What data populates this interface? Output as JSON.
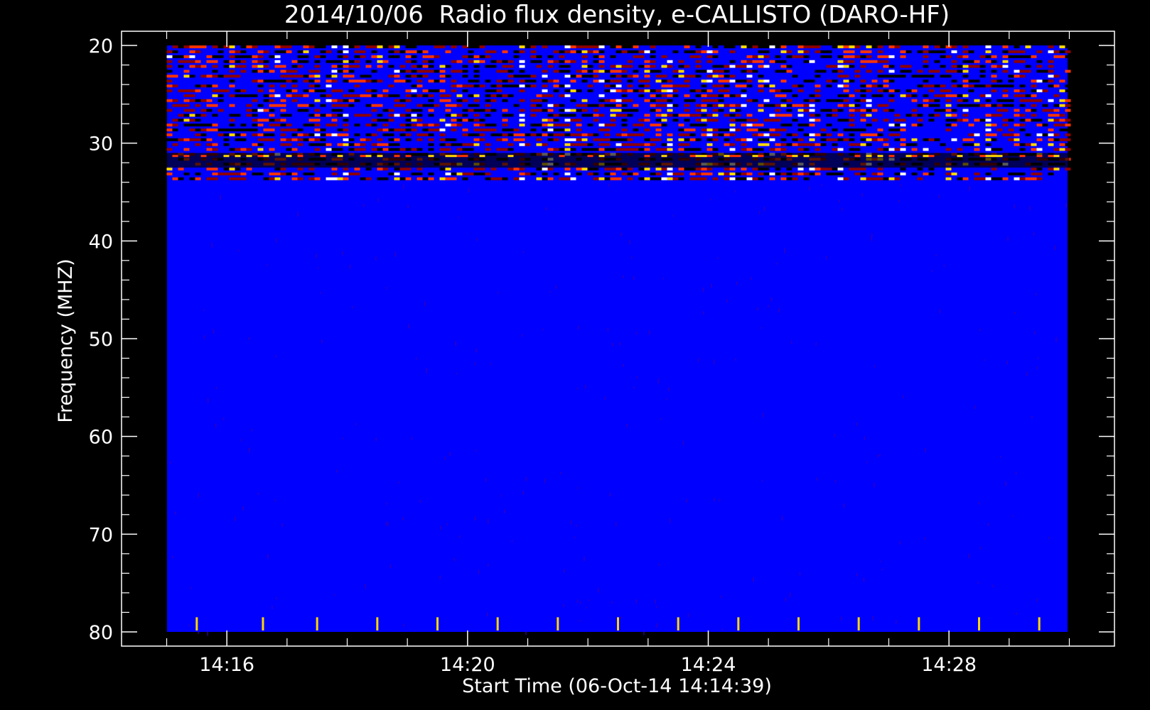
{
  "chart_data": {
    "type": "heatmap",
    "title": "2014/10/06  Radio flux density, e-CALLISTO (DARO-HF)",
    "xlabel": "Start Time (06-Oct-14 14:14:39)",
    "ylabel": "Frequency (MHZ)",
    "x_tick_labels": [
      "14:16",
      "14:20",
      "14:24",
      "14:28"
    ],
    "y_tick_labels": [
      "20",
      "30",
      "40",
      "50",
      "60",
      "70",
      "80"
    ],
    "x_range_minutes": [
      14.25,
      30.75
    ],
    "data_time_range_minutes": [
      15.0,
      30.0
    ],
    "ylim_mhz": [
      80,
      20
    ],
    "colormap": [
      "#000000",
      "#0000ff",
      "#8b0000",
      "#ff3300",
      "#ffd700",
      "#ffffff"
    ],
    "background_color": "#0000ff",
    "features": [
      {
        "name": "interference band",
        "freq_mhz": [
          20,
          34
        ],
        "intensity": "high"
      },
      {
        "name": "narrow horizontal emission",
        "freq_mhz": [
          31,
          32.5
        ],
        "intensity": "high"
      },
      {
        "name": "periodic spikes",
        "freq_mhz": [
          78.5,
          80
        ],
        "intensity": "spike"
      }
    ],
    "spike_times_minutes": [
      15.5,
      16.6,
      17.5,
      18.5,
      19.5,
      20.5,
      21.5,
      22.5,
      23.5,
      24.5,
      25.5,
      26.5,
      27.5,
      28.5,
      29.5
    ]
  }
}
